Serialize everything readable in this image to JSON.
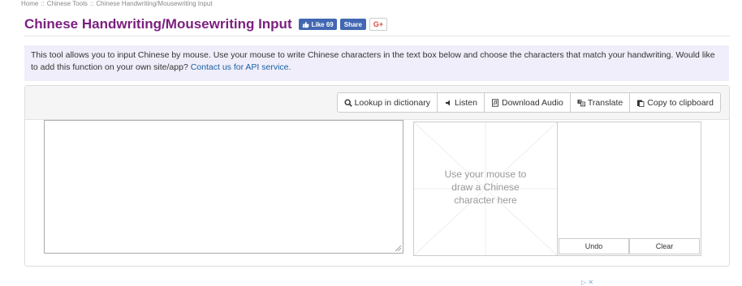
{
  "breadcrumb": {
    "home": "Home",
    "chinese_tools": "Chinese Tools",
    "current": "Chinese Handwriting/Mousewriting Input",
    "separator": "::"
  },
  "header": {
    "title": "Chinese Handwriting/Mousewriting Input",
    "like_label": "Like 69",
    "share_label": "Share",
    "gplus_label": "G+"
  },
  "intro": {
    "text": "This tool allows you to input Chinese by mouse. Use your mouse to write Chinese characters in the text box below and choose the characters that match your handwriting. Would like to add this function on your own site/app? ",
    "link": "Contact us for API service."
  },
  "toolbar": {
    "lookup_label": "Lookup in dictionary",
    "listen_label": "Listen",
    "download_label": "Download Audio",
    "translate_label": "Translate",
    "copy_label": "Copy to clipboard"
  },
  "editor": {
    "value": ""
  },
  "draw_pad": {
    "hint": "Use your mouse to draw a Chinese character here"
  },
  "candidates": {
    "undo_label": "Undo",
    "clear_label": "Clear"
  },
  "ad": {
    "mark": "▷ ✕"
  },
  "colors": {
    "title": "#7b1f7f",
    "facebook": "#4267b2",
    "gplus": "#dd4b39",
    "intro_bg": "#efeefa",
    "link": "#1a5fa3"
  }
}
